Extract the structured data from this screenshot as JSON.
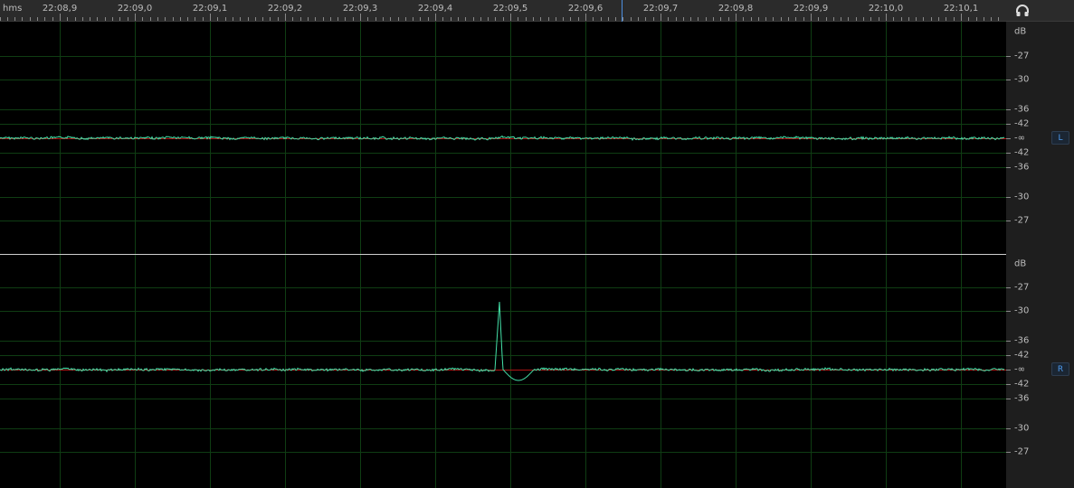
{
  "ruler": {
    "unit": "hms",
    "labels": [
      "22:08,9",
      "22:09,0",
      "22:09,1",
      "22:09,2",
      "22:09,3",
      "22:09,4",
      "22:09,5",
      "22:09,6",
      "22:09,7",
      "22:09,8",
      "22:09,9",
      "22:10,0",
      "22:10,1"
    ]
  },
  "scale": {
    "unit": "dB",
    "labels": [
      "-27",
      "-30",
      "-36",
      "-42",
      "-∞",
      "-42",
      "-36",
      "-30",
      "-27"
    ]
  },
  "channels": [
    {
      "label": "L"
    },
    {
      "label": "R"
    }
  ],
  "colors": {
    "waveform": "#44e0a8",
    "grid": "#0f3d13",
    "center_line": "#b01515",
    "playhead": "#4d8fe0"
  },
  "icons": {
    "monitor": "headphones-icon"
  },
  "playhead_time": "22:09,64"
}
